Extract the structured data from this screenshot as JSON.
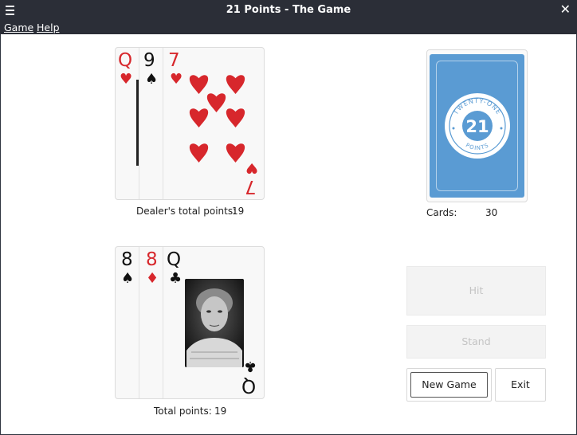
{
  "window": {
    "title": "21 Points - The Game"
  },
  "menu": {
    "game": "Game",
    "help": "Help"
  },
  "dealer": {
    "cards": [
      {
        "rank": "Q",
        "suit": "♥",
        "color": "#d7272c"
      },
      {
        "rank": "9",
        "suit": "♠",
        "color": "#111111"
      },
      {
        "rank": "7",
        "suit": "♥",
        "color": "#d7272c"
      }
    ],
    "label": "Dealer's total points:",
    "points": "19"
  },
  "deck": {
    "logo_top": "TWENTY-ONE",
    "logo_number": "21",
    "logo_bottom": "POINTS",
    "cards_label": "Cards:",
    "cards_count": "30",
    "back_color": "#5a9bd3"
  },
  "player": {
    "cards": [
      {
        "rank": "8",
        "suit": "♠",
        "color": "#111111"
      },
      {
        "rank": "8",
        "suit": "♦",
        "color": "#d7272c"
      },
      {
        "rank": "Q",
        "suit": "♣",
        "color": "#111111"
      }
    ],
    "label": "Total points:",
    "points": "19"
  },
  "buttons": {
    "hit": "Hit",
    "stand": "Stand",
    "new_game": "New Game",
    "exit": "Exit"
  }
}
